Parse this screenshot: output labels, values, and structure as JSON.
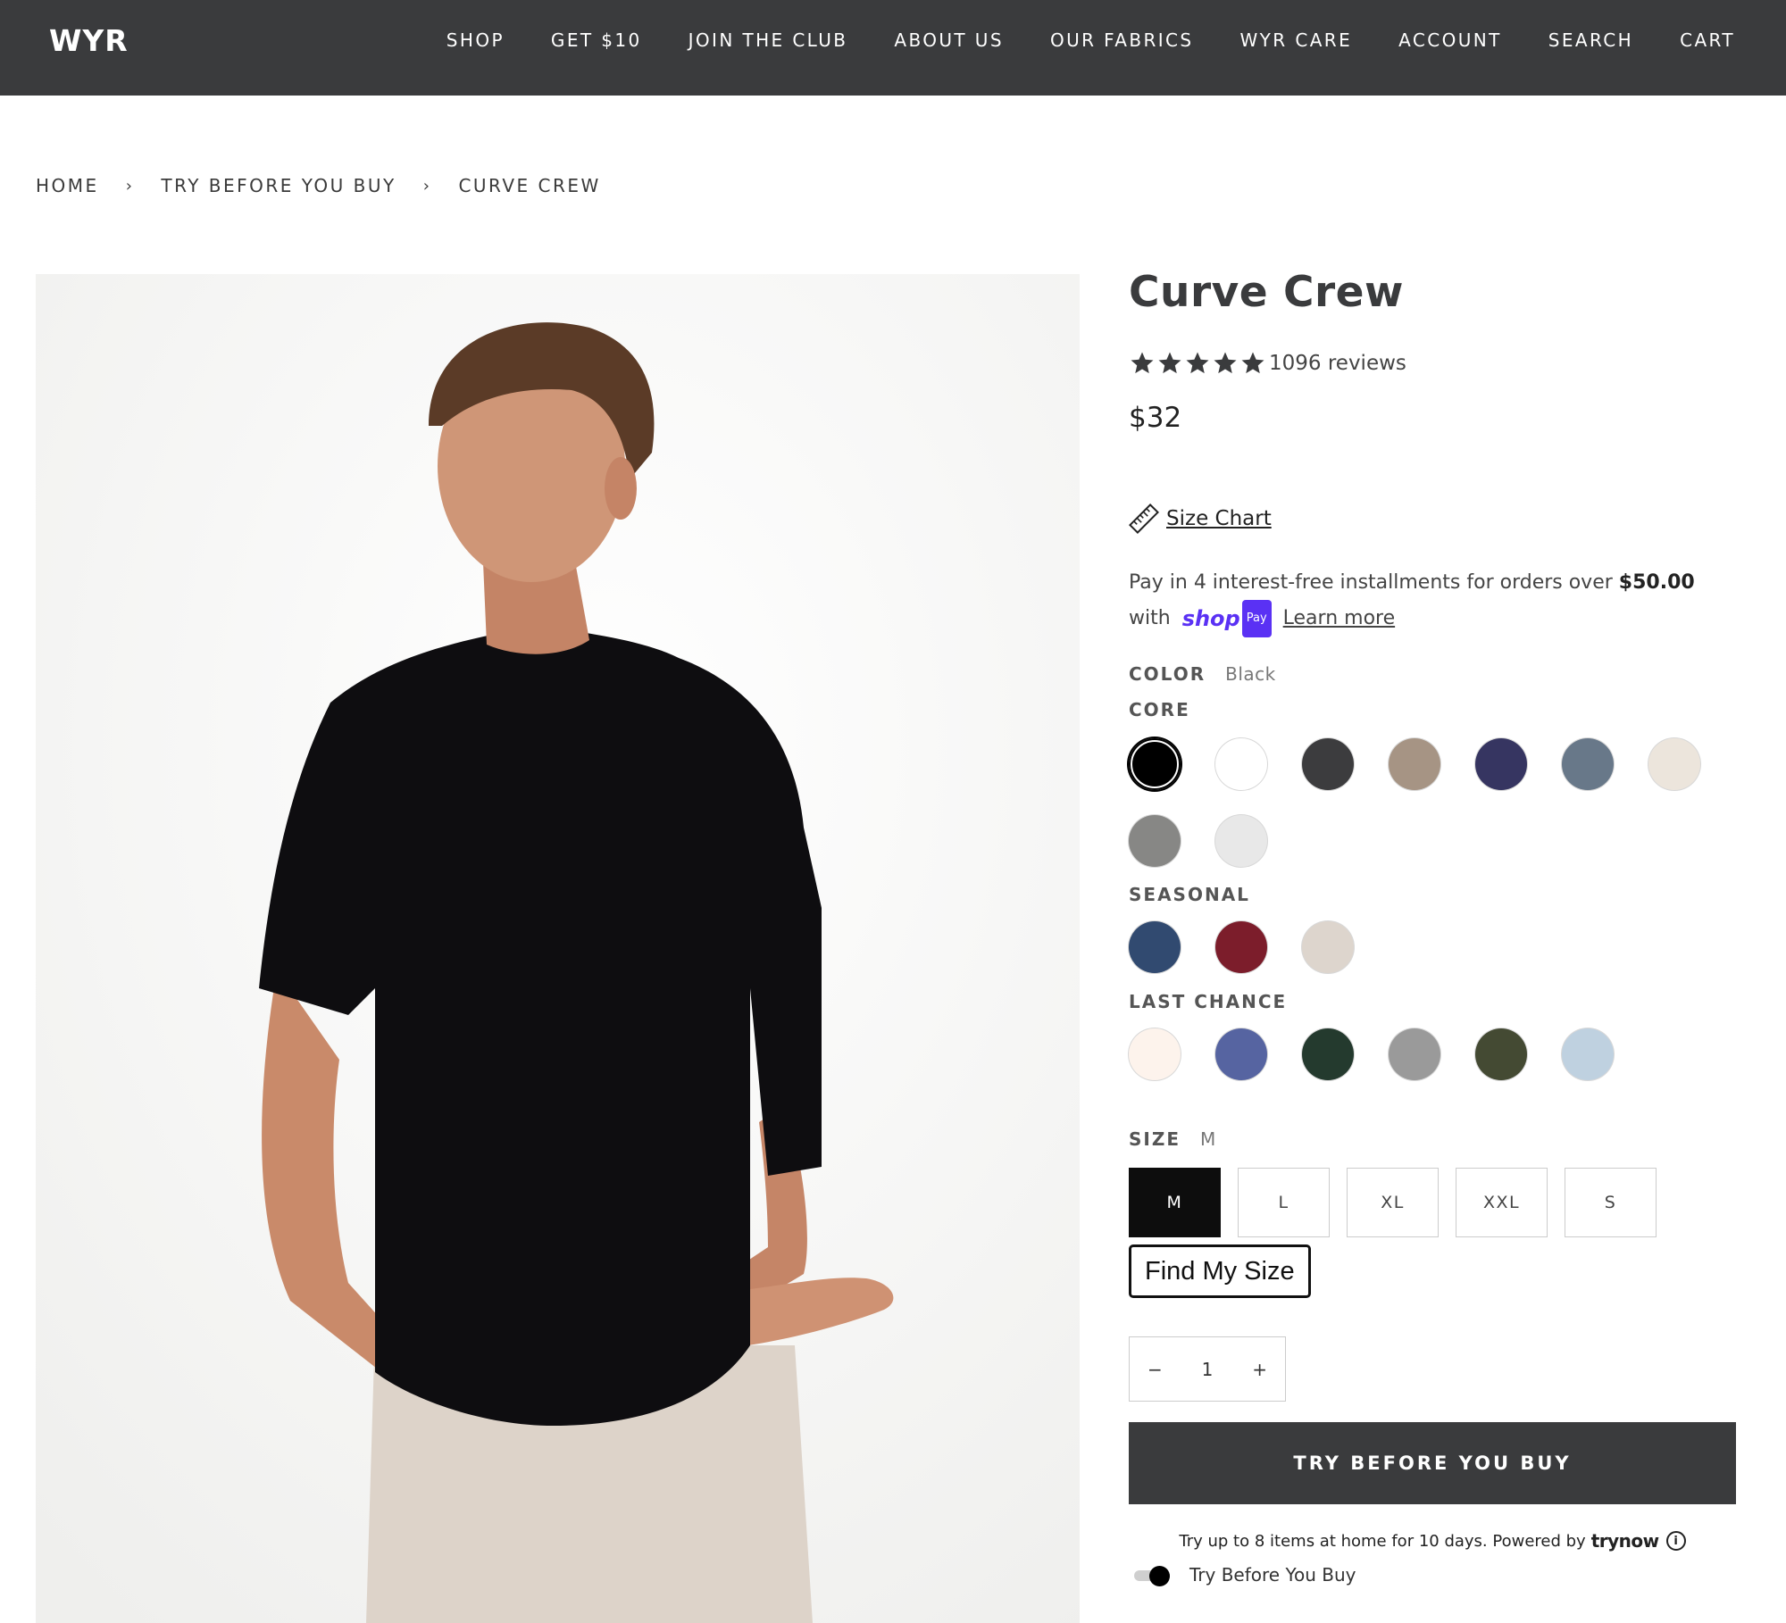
{
  "header": {
    "logo": "WYR",
    "nav": [
      "SHOP",
      "GET $10",
      "JOIN THE CLUB",
      "ABOUT US",
      "OUR FABRICS",
      "WYR CARE",
      "ACCOUNT",
      "SEARCH",
      "CART"
    ]
  },
  "breadcrumb": {
    "items": [
      "HOME",
      "TRY BEFORE YOU BUY",
      "CURVE CREW"
    ],
    "separator": "›"
  },
  "product": {
    "title": "Curve Crew",
    "rating_stars": 5,
    "reviews_text": "1096 reviews",
    "price": "$32",
    "size_chart_label": "Size Chart",
    "installments_text": "Pay in 4 interest-free installments for orders over",
    "installments_amount": "$50.00",
    "installments_with": "with",
    "shop_pay_word": "shop",
    "shop_pay_badge": "Pay",
    "learn_more": "Learn more"
  },
  "color": {
    "label": "COLOR",
    "selected": "Black",
    "groups": [
      {
        "label": "CORE",
        "swatches": [
          "#000000",
          "#ffffff",
          "#3c3c3e",
          "#a69484",
          "#363561",
          "#687889",
          "#ece5dc",
          "#878785",
          "#e8e8e8"
        ],
        "selected_index": 0
      },
      {
        "label": "SEASONAL",
        "swatches": [
          "#314a70",
          "#7c1d2b",
          "#ddd5cd"
        ]
      },
      {
        "label": "LAST CHANCE",
        "swatches": [
          "#fdf3ec",
          "#5664a1",
          "#243a2e",
          "#9a9a9a",
          "#444a33",
          "#bfd1e0"
        ]
      }
    ]
  },
  "size": {
    "label": "SIZE",
    "selected": "M",
    "options": [
      "M",
      "L",
      "XL",
      "XXL",
      "S"
    ],
    "find_my_size": "Find My Size"
  },
  "quantity": {
    "minus": "−",
    "value": "1",
    "plus": "+"
  },
  "cta": {
    "label": "TRY BEFORE YOU BUY",
    "note": "Try up to 8 items at home for 10 days. Powered by",
    "brand": "trynow",
    "toggle_label": "Try Before You Buy"
  }
}
